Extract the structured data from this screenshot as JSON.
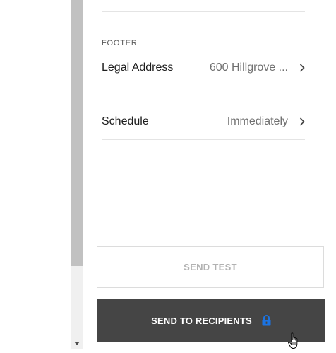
{
  "footer": {
    "section_label": "FOOTER",
    "legal_address": {
      "label": "Legal Address",
      "value": "600 Hillgrove ..."
    }
  },
  "schedule": {
    "label": "Schedule",
    "value": "Immediately"
  },
  "actions": {
    "send_test": "SEND TEST",
    "send_to_recipients": "SEND TO RECIPIENTS"
  },
  "icons": {
    "row_chevron": "chevron-right-icon",
    "send_lock": "lock-icon",
    "scroll_arrow": "chevron-down-icon",
    "pointer": "hand-pointer-icon"
  },
  "colors": {
    "primary_button": "#454545",
    "lock_accent": "#1b74e4",
    "disabled_text": "#b2b2b2"
  }
}
